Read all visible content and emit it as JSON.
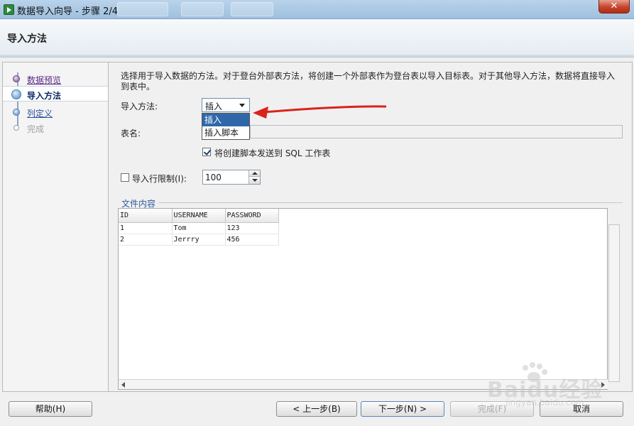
{
  "window": {
    "title": "数据导入向导 - 步骤 2/4",
    "close_label": "✕"
  },
  "header": {
    "title": "导入方法"
  },
  "steps": [
    {
      "label": "数据预览",
      "state": "done"
    },
    {
      "label": "导入方法",
      "state": "current"
    },
    {
      "label": "列定义",
      "state": "link"
    },
    {
      "label": "完成",
      "state": "future"
    }
  ],
  "main": {
    "description": "选择用于导入数据的方法。对于登台外部表方法，将创建一个外部表作为登台表以导入目标表。对于其他导入方法，数据将直接导入到表中。",
    "import_method_label": "导入方法:",
    "import_method_value": "插入",
    "import_method_options": [
      "插入",
      "插入脚本"
    ],
    "table_name_label": "表名:",
    "table_name_value": "",
    "send_script_label": "将创建脚本发送到 SQL 工作表",
    "send_script_checked": true,
    "row_limit_label": "导入行限制(I):",
    "row_limit_checked": false,
    "row_limit_value": "100",
    "file_contents_title": "文件内容"
  },
  "table": {
    "columns": [
      "ID",
      "USERNAME",
      "PASSWORD"
    ],
    "rows": [
      [
        "1",
        "Tom",
        "123"
      ],
      [
        "2",
        "Jerrry",
        "456"
      ]
    ]
  },
  "footer": {
    "help": "帮助(H)",
    "back": "< 上一步(B)",
    "next": "下一步(N) >",
    "finish": "完成(F)",
    "cancel": "取消"
  },
  "watermark": {
    "brand": "Baidu经验",
    "url": "jingyan.baidu.com"
  },
  "colors": {
    "accent": "#2f68a8",
    "annotation_arrow": "#d9231b"
  }
}
